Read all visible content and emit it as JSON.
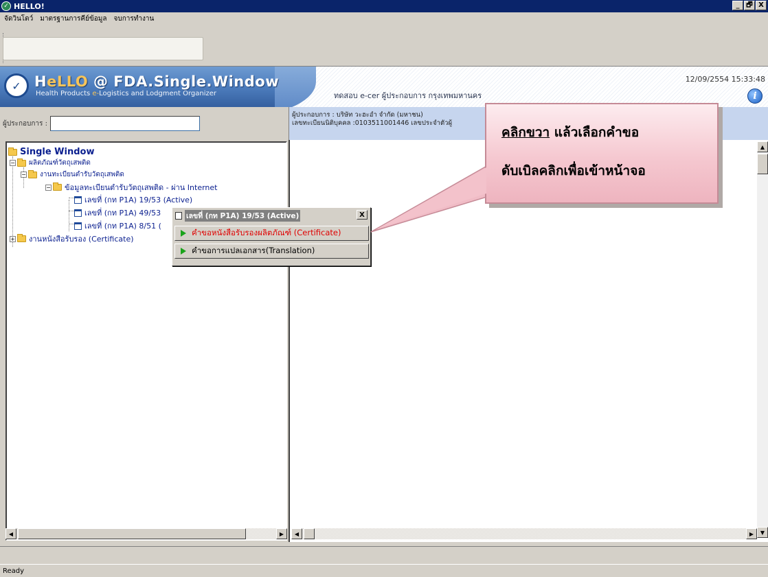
{
  "window": {
    "title": "HELLO!",
    "min_label": "_",
    "max_label": "🗗",
    "close_label": "X"
  },
  "menu": {
    "items": [
      "จัดวินโดว์",
      "มาตรฐานการคีย์ข้อมูล",
      "จบการทำงาน"
    ]
  },
  "banner": {
    "brand_title_a": "H",
    "brand_title_b": "eLLO",
    "brand_title_c": " @ FDA.Single.Window",
    "brand_sub_a": "Health Products ",
    "brand_sub_b": "e-",
    "brand_sub_c": "Logistics and Lodgment Organizer",
    "center_text": "ทดสอบ e-cer ผู้ประกอบการ  กรุงเทพมหานคร",
    "datetime": "12/09/2554 15:33:48",
    "info_glyph": "i"
  },
  "left_header": {
    "label": "ผู้ประกอบการ :"
  },
  "right_header": {
    "line1": "ผู้ประกอบการ :  บริษัท วะฮะอำ จำกัด (มหาชน)",
    "line2": "เลขทะเบียนนิติบุคคล :0103511001446 เลขประจำตัวผู้"
  },
  "tree": {
    "root": "Single Window",
    "level1": "ผลิตภัณฑ์วัตถุเสพติด",
    "level2a": "งานทะเบียนตำรับวัตถุเสพติด",
    "level3": "ข้อมูลทะเบียนตำรับวัตถุเสพติด - ผ่าน Internet",
    "leaf1": "เลขที่ (กท P1A) 19/53 (Active)",
    "leaf2": "เลขที่ (กท P1A) 49/53",
    "leaf3": "เลขที่ (กท P1A) 8/51 (",
    "level2b": "งานหนังสือรับรอง (Certificate)"
  },
  "context_menu": {
    "title": "เลขที่ (กท P1A) 19/53 (Active)",
    "close_label": "X",
    "item1": "คำขอหนังสือรับรองผลิตภัณฑ์ (Certificate)",
    "item2": "คำขอการแปลเอกสาร(Translation)"
  },
  "callout": {
    "line1_underlined": "คลิกขวา",
    "line1_rest": " แล้วเลือกคำขอ",
    "line2": "ดับเบิลคลิกเพื่อเข้าหน้าจอ"
  },
  "status": {
    "text": "Ready"
  },
  "colors": {
    "titlebar": "#0a246a",
    "tree_text": "#0a1f8f",
    "menu_highlight": "#e00000",
    "callout_fill": "#f5c8d0"
  },
  "icons": {
    "app": "hello-logo-icon",
    "info": "info-icon",
    "folder": "folder-icon",
    "document": "document-icon",
    "play": "play-icon"
  }
}
